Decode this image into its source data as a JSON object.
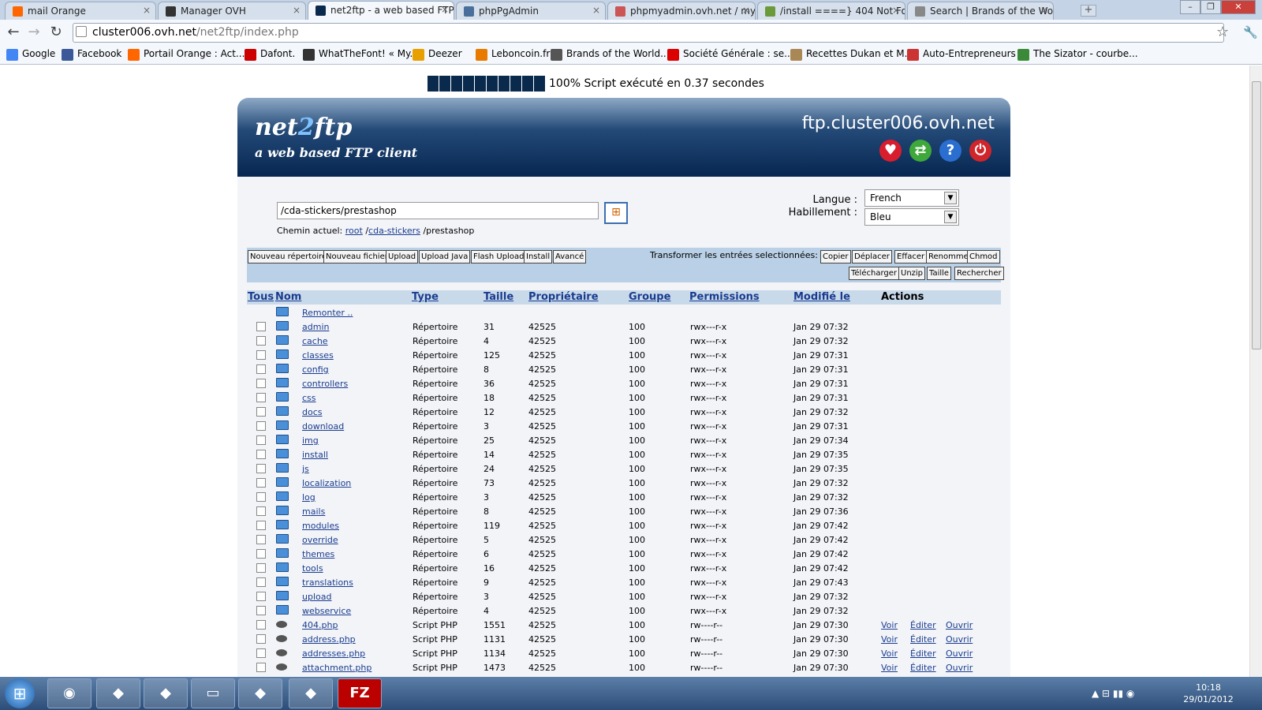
{
  "browser": {
    "tabs": [
      {
        "label": "mail Orange",
        "color": "#f60"
      },
      {
        "label": "Manager OVH",
        "color": "#333"
      },
      {
        "label": "net2ftp - a web based FTP c",
        "color": "#0a2a4d"
      },
      {
        "label": "phpPgAdmin",
        "color": "#4a6f9a"
      },
      {
        "label": "phpmyadmin.ovh.net / my",
        "color": "#c55"
      },
      {
        "label": "/install ====} 404 Not Foun",
        "color": "#6a9a3a"
      },
      {
        "label": "Search | Brands of the Worl",
        "color": "#888"
      }
    ],
    "url_host": "cluster006.ovh.net",
    "url_path": "/net2ftp/index.php",
    "bookmarks": [
      {
        "label": "Google",
        "color": "#4285f4"
      },
      {
        "label": "Facebook",
        "color": "#3b5998"
      },
      {
        "label": "Portail Orange : Act...",
        "color": "#f60"
      },
      {
        "label": "Dafont.",
        "color": "#c00"
      },
      {
        "label": "WhatTheFont! « My...",
        "color": "#333"
      },
      {
        "label": "Deezer",
        "color": "#e8a000"
      },
      {
        "label": "Leboncoin.fr",
        "color": "#e87a00"
      },
      {
        "label": "Brands of the World...",
        "color": "#555"
      },
      {
        "label": "Société Générale : se...",
        "color": "#d00"
      },
      {
        "label": "Recettes Dukan et M...",
        "color": "#a85"
      },
      {
        "label": "Auto-Entrepreneurs",
        "color": "#c33"
      },
      {
        "label": "The Sizator - courbe...",
        "color": "#3a8a3a"
      }
    ]
  },
  "progress": {
    "percent": 100,
    "text": "100% Script exécuté en 0.37 secondes"
  },
  "header": {
    "logo_a": "net",
    "logo_b": "2",
    "logo_c": "ftp",
    "tagline": "a web based FTP client",
    "host": "ftp.cluster006.ovh.net"
  },
  "browse": {
    "path_value": "/cda-stickers/prestashop",
    "chemin_label": "Chemin actuel:",
    "crumb_root": "root",
    "crumb_sep1": "/",
    "crumb_1": "cda-stickers",
    "crumb_last": "/prestashop",
    "langue_label": "Langue :",
    "langue_value": "French",
    "habillement_label": "Habillement :",
    "habillement_value": "Bleu"
  },
  "actions": {
    "left": [
      "Nouveau répertoire",
      "Nouveau fichier",
      "Upload",
      "Upload Java",
      "Flash Upload",
      "Install",
      "Avancé"
    ],
    "transform_label": "Transformer les entrées selectionnées:",
    "right_row1": [
      "Copier",
      "Déplacer",
      "Effacer",
      "Renommer",
      "Chmod"
    ],
    "right_row2": [
      "Télécharger",
      "Unzip",
      "Taille",
      "Rechercher"
    ]
  },
  "table": {
    "headers": {
      "all": "Tous",
      "name": "Nom",
      "type": "Type",
      "size": "Taille",
      "owner": "Propriétaire",
      "group": "Groupe",
      "perms": "Permissions",
      "modified": "Modifié le",
      "actions": "Actions"
    },
    "up_label": "Remonter ..",
    "action_labels": {
      "view": "Voir",
      "edit": "Éditer",
      "open": "Ouvrir"
    },
    "rows": [
      {
        "name": "admin",
        "type": "Répertoire",
        "size": "31",
        "owner": "42525",
        "group": "100",
        "perms": "rwx---r-x",
        "date": "Jan 29 07:32",
        "kind": "dir"
      },
      {
        "name": "cache",
        "type": "Répertoire",
        "size": "4",
        "owner": "42525",
        "group": "100",
        "perms": "rwx---r-x",
        "date": "Jan 29 07:32",
        "kind": "dir"
      },
      {
        "name": "classes",
        "type": "Répertoire",
        "size": "125",
        "owner": "42525",
        "group": "100",
        "perms": "rwx---r-x",
        "date": "Jan 29 07:31",
        "kind": "dir"
      },
      {
        "name": "config",
        "type": "Répertoire",
        "size": "8",
        "owner": "42525",
        "group": "100",
        "perms": "rwx---r-x",
        "date": "Jan 29 07:31",
        "kind": "dir"
      },
      {
        "name": "controllers",
        "type": "Répertoire",
        "size": "36",
        "owner": "42525",
        "group": "100",
        "perms": "rwx---r-x",
        "date": "Jan 29 07:31",
        "kind": "dir"
      },
      {
        "name": "css",
        "type": "Répertoire",
        "size": "18",
        "owner": "42525",
        "group": "100",
        "perms": "rwx---r-x",
        "date": "Jan 29 07:31",
        "kind": "dir"
      },
      {
        "name": "docs",
        "type": "Répertoire",
        "size": "12",
        "owner": "42525",
        "group": "100",
        "perms": "rwx---r-x",
        "date": "Jan 29 07:32",
        "kind": "dir"
      },
      {
        "name": "download",
        "type": "Répertoire",
        "size": "3",
        "owner": "42525",
        "group": "100",
        "perms": "rwx---r-x",
        "date": "Jan 29 07:31",
        "kind": "dir"
      },
      {
        "name": "img",
        "type": "Répertoire",
        "size": "25",
        "owner": "42525",
        "group": "100",
        "perms": "rwx---r-x",
        "date": "Jan 29 07:34",
        "kind": "dir"
      },
      {
        "name": "install",
        "type": "Répertoire",
        "size": "14",
        "owner": "42525",
        "group": "100",
        "perms": "rwx---r-x",
        "date": "Jan 29 07:35",
        "kind": "dir"
      },
      {
        "name": "js",
        "type": "Répertoire",
        "size": "24",
        "owner": "42525",
        "group": "100",
        "perms": "rwx---r-x",
        "date": "Jan 29 07:35",
        "kind": "dir"
      },
      {
        "name": "localization",
        "type": "Répertoire",
        "size": "73",
        "owner": "42525",
        "group": "100",
        "perms": "rwx---r-x",
        "date": "Jan 29 07:32",
        "kind": "dir"
      },
      {
        "name": "log",
        "type": "Répertoire",
        "size": "3",
        "owner": "42525",
        "group": "100",
        "perms": "rwx---r-x",
        "date": "Jan 29 07:32",
        "kind": "dir"
      },
      {
        "name": "mails",
        "type": "Répertoire",
        "size": "8",
        "owner": "42525",
        "group": "100",
        "perms": "rwx---r-x",
        "date": "Jan 29 07:36",
        "kind": "dir"
      },
      {
        "name": "modules",
        "type": "Répertoire",
        "size": "119",
        "owner": "42525",
        "group": "100",
        "perms": "rwx---r-x",
        "date": "Jan 29 07:42",
        "kind": "dir"
      },
      {
        "name": "override",
        "type": "Répertoire",
        "size": "5",
        "owner": "42525",
        "group": "100",
        "perms": "rwx---r-x",
        "date": "Jan 29 07:42",
        "kind": "dir"
      },
      {
        "name": "themes",
        "type": "Répertoire",
        "size": "6",
        "owner": "42525",
        "group": "100",
        "perms": "rwx---r-x",
        "date": "Jan 29 07:42",
        "kind": "dir"
      },
      {
        "name": "tools",
        "type": "Répertoire",
        "size": "16",
        "owner": "42525",
        "group": "100",
        "perms": "rwx---r-x",
        "date": "Jan 29 07:42",
        "kind": "dir"
      },
      {
        "name": "translations",
        "type": "Répertoire",
        "size": "9",
        "owner": "42525",
        "group": "100",
        "perms": "rwx---r-x",
        "date": "Jan 29 07:43",
        "kind": "dir"
      },
      {
        "name": "upload",
        "type": "Répertoire",
        "size": "3",
        "owner": "42525",
        "group": "100",
        "perms": "rwx---r-x",
        "date": "Jan 29 07:32",
        "kind": "dir"
      },
      {
        "name": "webservice",
        "type": "Répertoire",
        "size": "4",
        "owner": "42525",
        "group": "100",
        "perms": "rwx---r-x",
        "date": "Jan 29 07:32",
        "kind": "dir"
      },
      {
        "name": "404.php",
        "type": "Script PHP",
        "size": "1551",
        "owner": "42525",
        "group": "100",
        "perms": "rw----r--",
        "date": "Jan 29 07:30",
        "kind": "php"
      },
      {
        "name": "address.php",
        "type": "Script PHP",
        "size": "1131",
        "owner": "42525",
        "group": "100",
        "perms": "rw----r--",
        "date": "Jan 29 07:30",
        "kind": "php"
      },
      {
        "name": "addresses.php",
        "type": "Script PHP",
        "size": "1134",
        "owner": "42525",
        "group": "100",
        "perms": "rw----r--",
        "date": "Jan 29 07:30",
        "kind": "php"
      },
      {
        "name": "attachment.php",
        "type": "Script PHP",
        "size": "1473",
        "owner": "42525",
        "group": "100",
        "perms": "rw----r--",
        "date": "Jan 29 07:30",
        "kind": "php"
      }
    ]
  },
  "taskbar": {
    "apps": [
      "chrome-icon",
      "explorer-icon",
      "notepad-icon",
      "folder-icon",
      "tools-icon",
      "photos-icon",
      "filezilla-icon"
    ],
    "filezilla_label": "FZ",
    "time": "10:18",
    "date": "29/01/2012"
  }
}
